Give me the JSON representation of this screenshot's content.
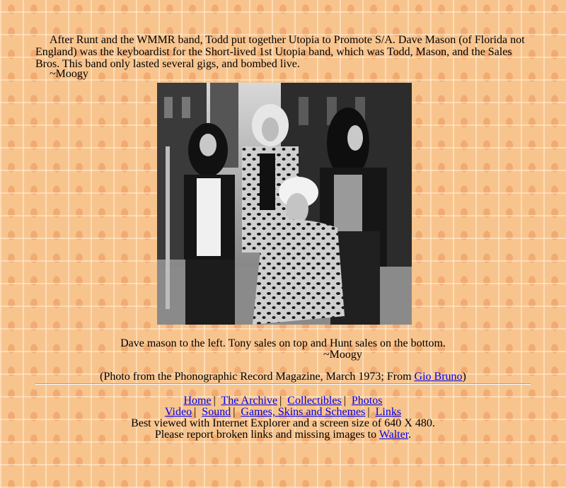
{
  "intro": {
    "paragraph": "After Runt and the WMMR band, Todd put together Utopia to Promote S/A. Dave Mason (of Florida not England) was the keyboardist for the Short-lived 1st Utopia band, which was Todd, Mason, and the Sales Bros. This band only lasted several gigs, and bombed live.",
    "signature": "~Moogy"
  },
  "photo": {
    "alt": "Black and white photo of the four members of the 1st Utopia band on a city street"
  },
  "caption": {
    "text": "Dave mason to the left. Tony sales on top and Hunt sales on the bottom.",
    "signature": "~Moogy"
  },
  "credit": {
    "before": "(Photo from the Phonographic Record Magazine, March 1973; From ",
    "link": "Gio Bruno",
    "after": ")"
  },
  "footer": {
    "nav_row1": [
      "Home",
      "The Archive",
      "Collectibles",
      "Photos"
    ],
    "nav_row2": [
      "Video",
      "Sound",
      "Games, Skins and Schemes",
      "Links"
    ],
    "separator": "|",
    "best_viewed": "Best viewed with Internet Explorer and a screen size of 640 X 480.",
    "report_before": "Please report broken links and missing images to ",
    "report_link": "Walter",
    "report_after": "."
  }
}
